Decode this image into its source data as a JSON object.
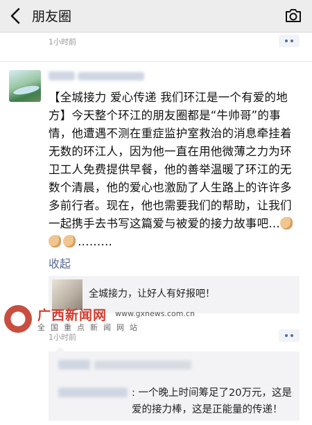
{
  "header": {
    "title": "朋友圈"
  },
  "prev_post": {
    "time": "1小时前"
  },
  "post": {
    "text": "【全城接力 爱心传递 我们环江是一个有爱的地方】今天整个环江的朋友圈都是“牛帅哥”的事情，他遭遇不测在重症监护室救治的消息牵挂着无数的环江人，因为他一直在用他微薄之力为环卫工人免费提供早餐，他的善举温暖了环江的无数个清晨，他的爱心也激励了人生路上的许许多多前行者。现在，他也需要我们的帮助，让我们一起携手去书写这篇爱与被爱的接力故事吧…",
    "ellipsis": "………",
    "collapse_label": "收起",
    "time": "1小时前",
    "shared_link": {
      "title": "全城接力，让好人有好报吧！"
    }
  },
  "watermark": {
    "title": "广西新闻网",
    "url": "www.gxnews.com.cn",
    "subtitle": "全国重点新闻网站"
  },
  "comment": {
    "text": ": 一个晚上时间筹足了20万元，这是爱的接力棒，这是正能量的传递！"
  },
  "colors": {
    "link": "#576b95",
    "topbar": "#ededed"
  }
}
